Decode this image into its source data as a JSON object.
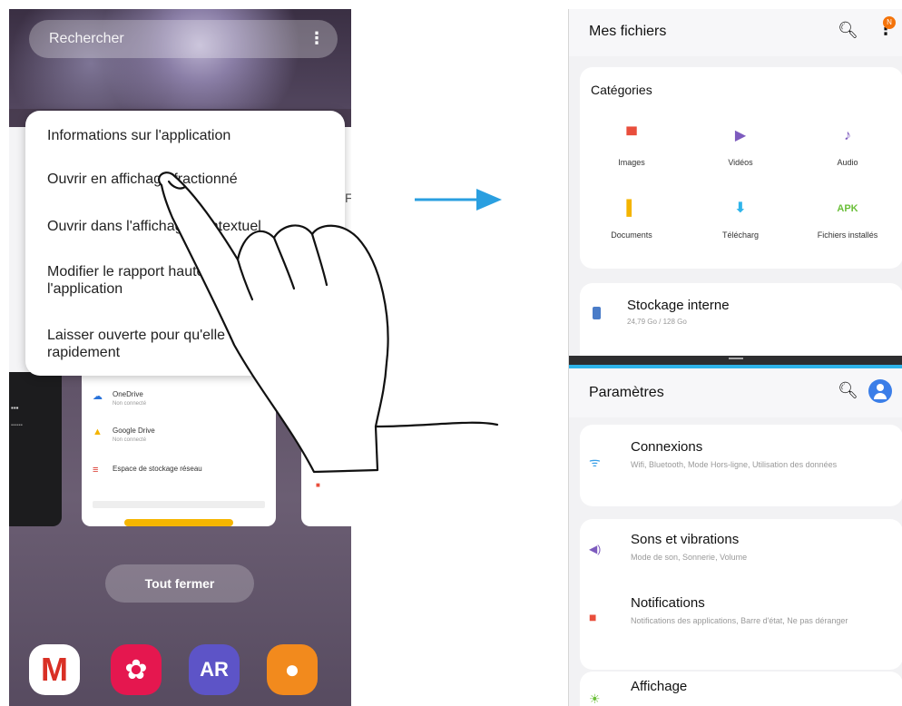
{
  "left_phone": {
    "search_placeholder": "Rechercher",
    "more_icon": "⋮",
    "popup_menu": [
      "Informations sur l'application",
      "Ouvrir en affichage fractionné",
      "Ouvrir dans l'affichage contextuel",
      "Modifier le rapport hauteur/largeur de l'application",
      "Laisser ouverte pour qu'elle se lance rapidement"
    ],
    "recent_storage_rows": [
      {
        "name": "OneDrive",
        "sub": "Non connecté",
        "icon": "cloud-icon",
        "color": "#2a73d9"
      },
      {
        "name": "Google Drive",
        "sub": "Non connecté",
        "icon": "drive-icon",
        "color": "#f4b400"
      },
      {
        "name": "Espace de stockage réseau",
        "sub": "",
        "icon": "network-storage-icon",
        "color": "#d93025"
      }
    ],
    "close_all_label": "Tout fermer",
    "dock": [
      {
        "name": "gmail-icon",
        "glyph": "M"
      },
      {
        "name": "flower-icon",
        "glyph": "✿"
      },
      {
        "name": "ar-icon",
        "glyph": "AR"
      },
      {
        "name": "contacts-icon",
        "glyph": "●"
      }
    ]
  },
  "right_phone": {
    "files_app": {
      "title": "Mes fichiers",
      "badge": "N",
      "categories_title": "Catégories",
      "categories": [
        {
          "label": "Images",
          "icon": "image-icon",
          "glyph": "▀",
          "color": "#e94e3c"
        },
        {
          "label": "Vidéos",
          "icon": "video-icon",
          "glyph": "▶",
          "color": "#7d5bbe"
        },
        {
          "label": "Audio",
          "icon": "audio-icon",
          "glyph": "♪",
          "color": "#7d5bbe"
        },
        {
          "label": "Documents",
          "icon": "document-icon",
          "glyph": "▌",
          "color": "#f4b400"
        },
        {
          "label": "Télécharg",
          "icon": "download-icon",
          "glyph": "⬇",
          "color": "#2fb4ea"
        },
        {
          "label": "Fichiers installés",
          "icon": "apk-icon",
          "glyph": "APK",
          "color": "#6bbf3a"
        }
      ],
      "storage_title": "Stockage interne",
      "storage_sub": "24,79 Go / 128 Go"
    },
    "settings_app": {
      "title": "Paramètres",
      "rows": [
        {
          "title": "Connexions",
          "sub": "Wifi, Bluetooth, Mode Hors-ligne, Utilisation des données",
          "icon": "wifi-icon",
          "glyph": "ᯤ",
          "color": "#3aa0e8"
        },
        {
          "title": "Sons et vibrations",
          "sub": "Mode de son, Sonnerie, Volume",
          "icon": "sound-icon",
          "glyph": "◀)",
          "color": "#7d5bbe"
        },
        {
          "title": "Notifications",
          "sub": "Notifications des applications, Barre d'état, Ne pas déranger",
          "icon": "notification-icon",
          "glyph": "■",
          "color": "#e94e3c"
        },
        {
          "title": "Affichage",
          "sub": "",
          "icon": "display-icon",
          "glyph": "☀",
          "color": "#6bbf3a"
        }
      ]
    }
  },
  "colors": {
    "arrow": "#2a9fe0",
    "split_accent": "#2fb4ea"
  }
}
